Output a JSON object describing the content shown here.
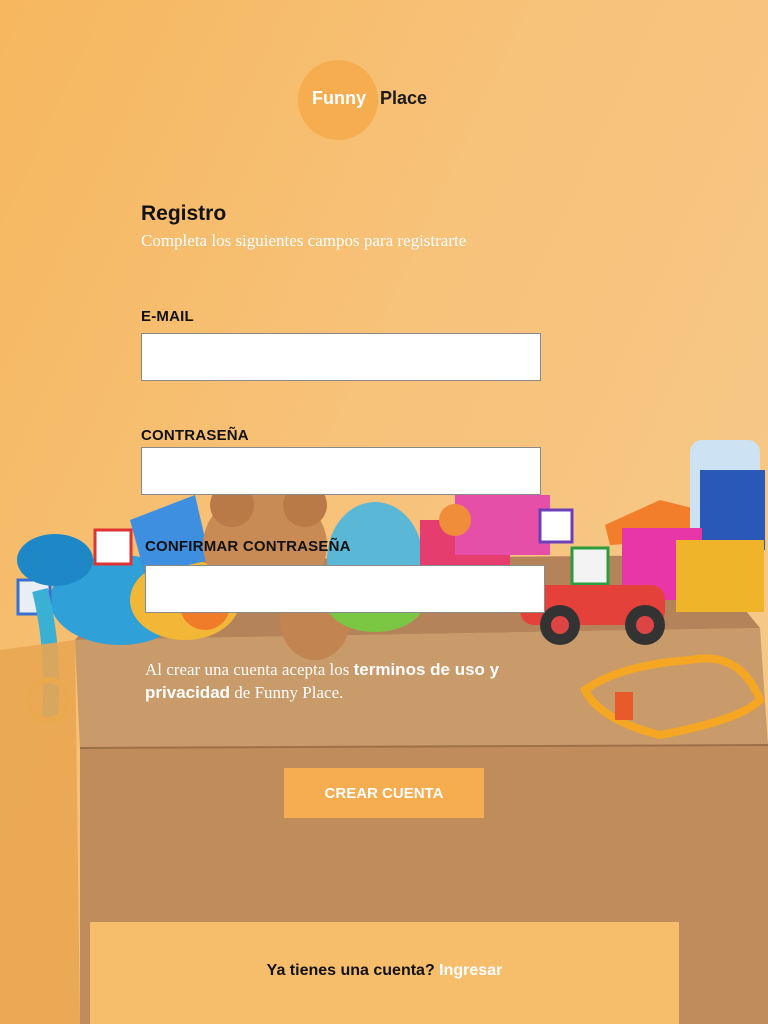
{
  "brand": {
    "word1": "Funny",
    "word2": "Place",
    "circle_color": "#f5ad4f"
  },
  "form": {
    "title": "Registro",
    "subtitle": "Completa los siguientes campos para registrarte",
    "email_label": "E-MAIL",
    "email_value": "",
    "password_label": "CONTRASEÑA",
    "password_value": "",
    "confirm_label": "CONFIRMAR CONTRASEÑA",
    "confirm_value": "",
    "terms_prefix": "Al crear una cuenta acepta los ",
    "terms_link": "terminos de uso y privacidad",
    "terms_suffix": " de Funny Place.",
    "submit_label": "CREAR CUENTA"
  },
  "footer": {
    "question": "Ya tienes una cuenta? ",
    "login_link": "Ingresar"
  },
  "background": {
    "image": "box-of-toys-photo"
  }
}
